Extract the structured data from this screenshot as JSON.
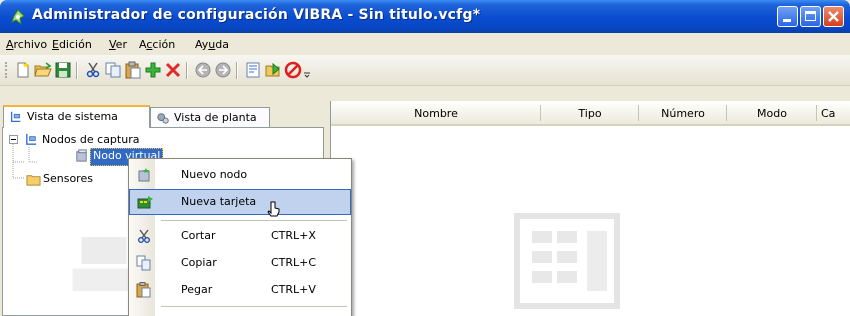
{
  "window": {
    "title": "Administrador de configuración VIBRA - Sin titulo.vcfg*",
    "title_color": "#ffffff",
    "titlebar_color": "#0a4bd0",
    "controls": [
      "minimize",
      "maximize",
      "close"
    ]
  },
  "menubar": {
    "items": [
      {
        "pre": "",
        "key": "A",
        "post": "rchivo"
      },
      {
        "pre": "",
        "key": "E",
        "post": "dición"
      },
      {
        "pre": "",
        "key": "V",
        "post": "er"
      },
      {
        "pre": "A",
        "key": "c",
        "post": "ción"
      },
      {
        "pre": "Ay",
        "key": "u",
        "post": "da"
      }
    ]
  },
  "toolbar": {
    "icons": [
      "new-icon",
      "open-icon",
      "save-icon",
      "cut-icon",
      "copy-icon",
      "paste-icon",
      "add-icon",
      "delete-icon",
      "back-icon",
      "forward-icon",
      "properties-icon",
      "export-icon",
      "stop-icon"
    ]
  },
  "tabs": [
    {
      "label": "Vista de sistema",
      "active": true
    },
    {
      "label": "Vista de planta",
      "active": false
    }
  ],
  "tree": {
    "root": "Nodos de captura",
    "child": "Nodo virtual",
    "sensors": "Sensores"
  },
  "table": {
    "columns": [
      "Nombre",
      "Tipo",
      "Número",
      "Modo",
      "Ca"
    ]
  },
  "context_menu": {
    "items": [
      {
        "label": "Nuevo nodo",
        "shortcut": ""
      },
      {
        "label": "Nueva tarjeta",
        "shortcut": ""
      },
      {
        "label": "Cortar",
        "shortcut": "CTRL+X"
      },
      {
        "label": "Copiar",
        "shortcut": "CTRL+C"
      },
      {
        "label": "Pegar",
        "shortcut": "CTRL+V"
      }
    ],
    "highlight_color": "#c1d2ee",
    "highlight_border": "#316ac5"
  }
}
